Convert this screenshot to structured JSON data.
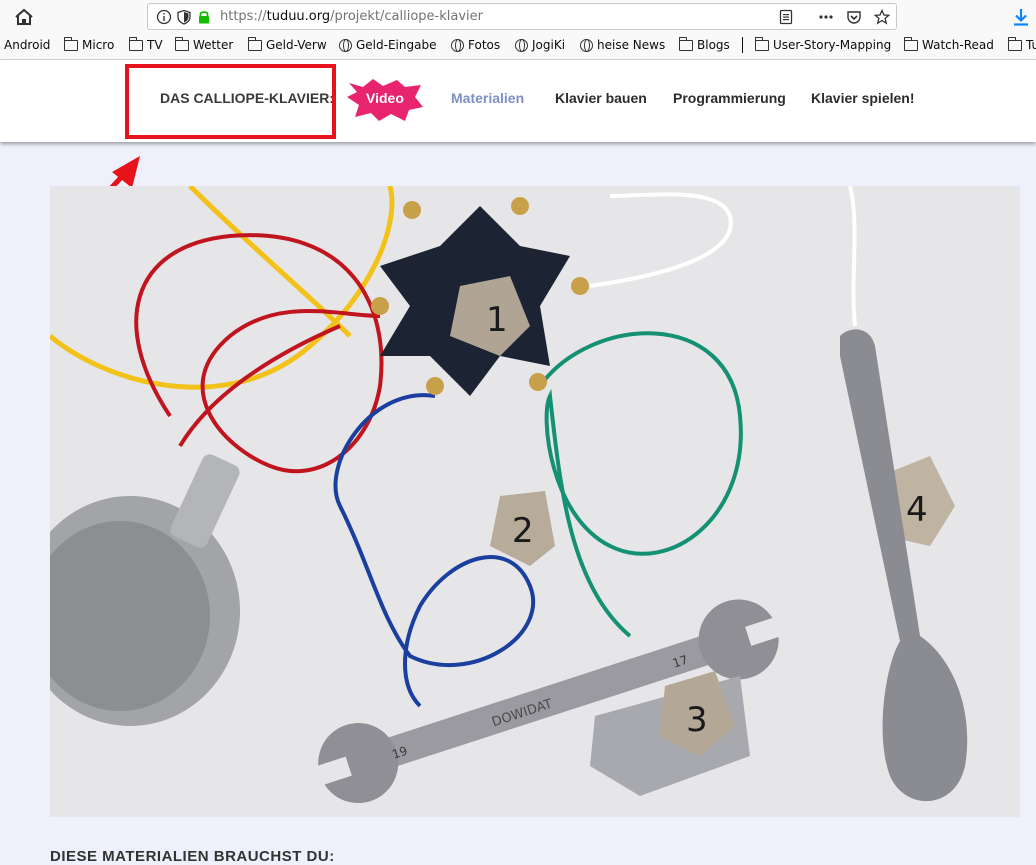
{
  "browser": {
    "url_prefix": "https://",
    "url_domain": "tuduu.org",
    "url_path": "/projekt/calliope-klavier"
  },
  "bookmarks": [
    "Android",
    "Micro",
    "TV",
    "Wetter",
    "Geld-Verw",
    "Geld-Eingabe",
    "Fotos",
    "JogiKi",
    "heise News",
    "Blogs",
    "User-Story-Mapping",
    "Watch-Read",
    "Tu"
  ],
  "site": {
    "brand": "DAS CALLIOPE-KLAVIER:",
    "video_label": "Video",
    "nav": [
      "Materialien",
      "Klavier bauen",
      "Programmierung",
      "Klavier spielen!"
    ]
  },
  "photo": {
    "labels": [
      "1",
      "2",
      "3",
      "4"
    ],
    "wrench_size_left": "17",
    "wrench_size_right": "19",
    "wrench_brand": "DOWIDAT"
  },
  "content": {
    "section_heading": "DIESE MATERIALIEN BRAUCHST DU:"
  },
  "colors": {
    "accent_active_nav": "#7f8fc2",
    "video_badge": "#e8246f",
    "highlight_box": "#e8131a",
    "page_background": "#eef0fb"
  }
}
